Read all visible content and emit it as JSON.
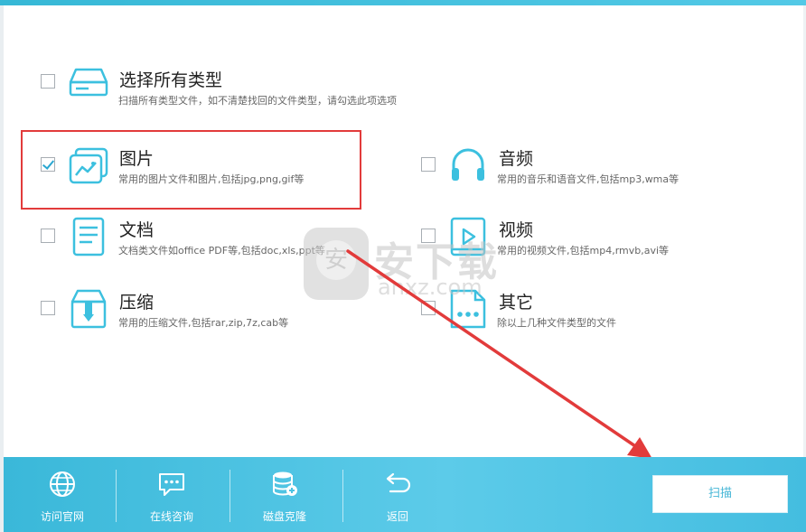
{
  "accent_color": "#3cc0df",
  "highlight_color": "#e23b3b",
  "options": [
    {
      "title": "选择所有类型",
      "desc": "扫描所有类型文件，如不清楚找回的文件类型，请勾选此项选项",
      "checked": false,
      "icon": "hard-drive-icon"
    },
    {
      "title": "图片",
      "desc": "常用的图片文件和图片,包括jpg,png,gif等",
      "checked": true,
      "icon": "picture-icon"
    },
    {
      "title": "音频",
      "desc": "常用的音乐和语音文件,包括mp3,wma等",
      "checked": false,
      "icon": "headphones-icon"
    },
    {
      "title": "文档",
      "desc": "文档类文件如office PDF等,包括doc,xls,ppt等",
      "checked": false,
      "icon": "document-icon"
    },
    {
      "title": "视频",
      "desc": "常用的视频文件,包括mp4,rmvb,avi等",
      "checked": false,
      "icon": "video-icon"
    },
    {
      "title": "压缩",
      "desc": "常用的压缩文件,包括rar,zip,7z,cab等",
      "checked": false,
      "icon": "archive-icon"
    },
    {
      "title": "其它",
      "desc": "除以上几种文件类型的文件",
      "checked": false,
      "icon": "other-files-icon"
    }
  ],
  "watermark": {
    "cn": "安下载",
    "en": "anxz.com",
    "badge": "安"
  },
  "bottom_nav": [
    {
      "label": "访问官网",
      "icon": "globe-icon"
    },
    {
      "label": "在线咨询",
      "icon": "chat-icon"
    },
    {
      "label": "磁盘克隆",
      "icon": "disk-clone-icon"
    },
    {
      "label": "返回",
      "icon": "back-arrow-icon"
    }
  ],
  "scan_button": "扫描"
}
